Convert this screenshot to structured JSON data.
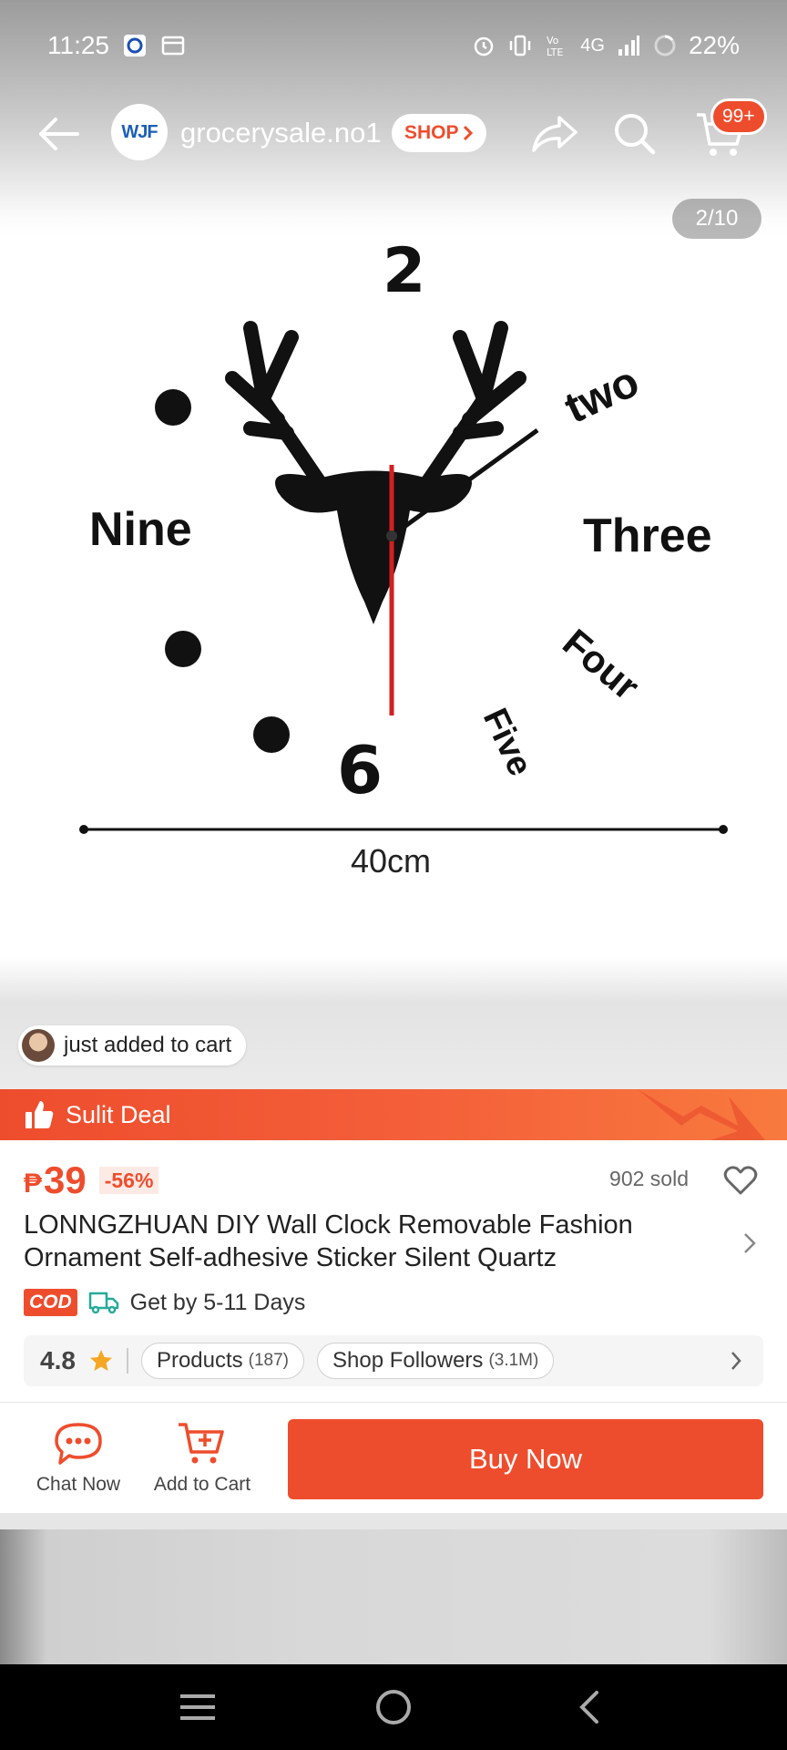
{
  "status_bar": {
    "time": "11:25",
    "battery": "22%",
    "network": "4G"
  },
  "header": {
    "shop_name": "grocerysale.no1",
    "shop_logo_text": "WJF",
    "shop_button_label": "SHOP",
    "cart_badge": "99+"
  },
  "gallery": {
    "page_indicator": "2/10",
    "clock_labels": [
      "2",
      "two",
      "Three",
      "Four",
      "Five",
      "6",
      "Nine"
    ],
    "dimension_label": "40cm",
    "recent_activity": "just added to cart"
  },
  "deal": {
    "label": "Sulit Deal"
  },
  "product": {
    "currency": "₱",
    "price": "39",
    "discount": "-56%",
    "sold": "902 sold",
    "title": "LONNGZHUAN DIY Wall Clock Removable Fashion Ornament Self-adhesive Sticker Silent Quartz",
    "cod_label": "COD",
    "delivery": "Get by 5-11 Days"
  },
  "shop_stats": {
    "rating": "4.8",
    "products_label": "Products",
    "products_count": "(187)",
    "followers_label": "Shop Followers",
    "followers_count": "(3.1M)"
  },
  "actions": {
    "chat": "Chat Now",
    "add_to_cart": "Add to Cart",
    "buy_now": "Buy Now"
  },
  "colors": {
    "accent": "#ee4d2d",
    "star": "#f5a623",
    "teal": "#26aa99"
  },
  "icons": [
    "back-arrow-icon",
    "share-icon",
    "search-icon",
    "cart-icon",
    "heart-icon",
    "chevron-right-icon",
    "chat-icon",
    "add-cart-icon",
    "truck-icon",
    "star-icon",
    "thumbs-up-icon",
    "menu-icon",
    "home-icon",
    "nav-back-icon"
  ]
}
